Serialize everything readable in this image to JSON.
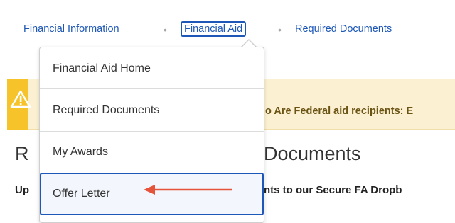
{
  "breadcrumb": {
    "items": [
      {
        "label": "Financial Information"
      },
      {
        "label": "Financial Aid"
      },
      {
        "label": "Required Documents"
      }
    ],
    "separator": "•"
  },
  "dropdown": {
    "items": [
      {
        "label": "Financial Aid Home"
      },
      {
        "label": "Required Documents"
      },
      {
        "label": "My Awards"
      },
      {
        "label": "Offer Letter"
      }
    ]
  },
  "alert": {
    "icon": "warning-icon",
    "text_visible": "o Are Federal aid recipients: E"
  },
  "page": {
    "title_left": "R",
    "title_right": "Documents",
    "subtitle_left": "Up",
    "subtitle_right": "nts to our Secure FA Dropb"
  },
  "annotation": {
    "arrow_color": "#e5533b"
  },
  "colors": {
    "link": "#1d57b7",
    "alert_bg": "#fbf1d2",
    "alert_accent": "#f6c32b"
  }
}
